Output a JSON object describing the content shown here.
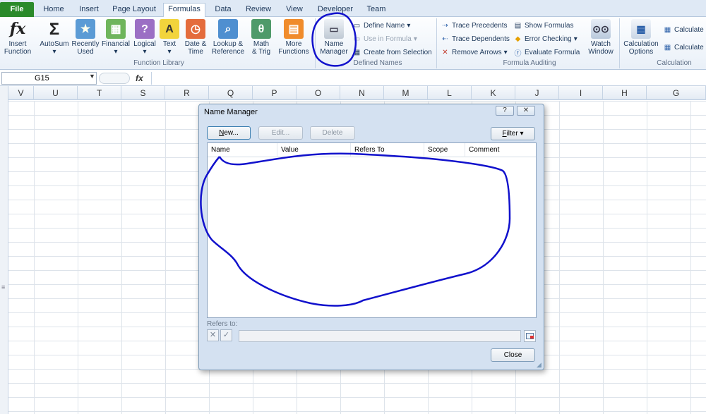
{
  "tabs": {
    "file": "File",
    "home": "Home",
    "insert": "Insert",
    "page_layout": "Page Layout",
    "formulas": "Formulas",
    "data": "Data",
    "review": "Review",
    "view": "View",
    "developer": "Developer",
    "team": "Team"
  },
  "ribbon": {
    "function_library": {
      "label": "Function Library",
      "insert_function": [
        "Insert",
        "Function"
      ],
      "autosum": "AutoSum",
      "recently_used": [
        "Recently",
        "Used"
      ],
      "financial": "Financial",
      "logical": "Logical",
      "text": "Text",
      "date_time": [
        "Date &",
        "Time"
      ],
      "lookup": [
        "Lookup &",
        "Reference"
      ],
      "math": [
        "Math",
        "& Trig"
      ],
      "more": [
        "More",
        "Functions"
      ]
    },
    "defined_names": {
      "label": "Defined Names",
      "name_manager": [
        "Name",
        "Manager"
      ],
      "define_name": "Define Name",
      "use_in_formula": "Use in Formula",
      "create_from_selection": "Create from Selection"
    },
    "formula_auditing": {
      "label": "Formula Auditing",
      "trace_precedents": "Trace Precedents",
      "trace_dependents": "Trace Dependents",
      "remove_arrows": "Remove Arrows",
      "show_formulas": "Show Formulas",
      "error_checking": "Error Checking",
      "evaluate_formula": "Evaluate Formula",
      "watch_window": [
        "Watch",
        "Window"
      ]
    },
    "calculation": {
      "label": "Calculation",
      "options": [
        "Calculation",
        "Options"
      ],
      "calc_now": "Calculate N",
      "calc_sheet": "Calculate S"
    }
  },
  "formula_bar": {
    "name_box": "G15",
    "fx": "fx",
    "value": ""
  },
  "columns": [
    "V",
    "U",
    "T",
    "S",
    "R",
    "Q",
    "P",
    "O",
    "N",
    "M",
    "L",
    "K",
    "J",
    "I",
    "H",
    "G"
  ],
  "dialog": {
    "title": "Name Manager",
    "help": "?",
    "close_x": "✕",
    "new": "New...",
    "edit": "Edit...",
    "delete": "Delete",
    "filter": "Filter",
    "headers": [
      "Name",
      "Value",
      "Refers To",
      "Scope",
      "Comment"
    ],
    "refers_to_label": "Refers to:",
    "refers_to_value": "",
    "close": "Close"
  },
  "annotation_color": "#1111cc"
}
